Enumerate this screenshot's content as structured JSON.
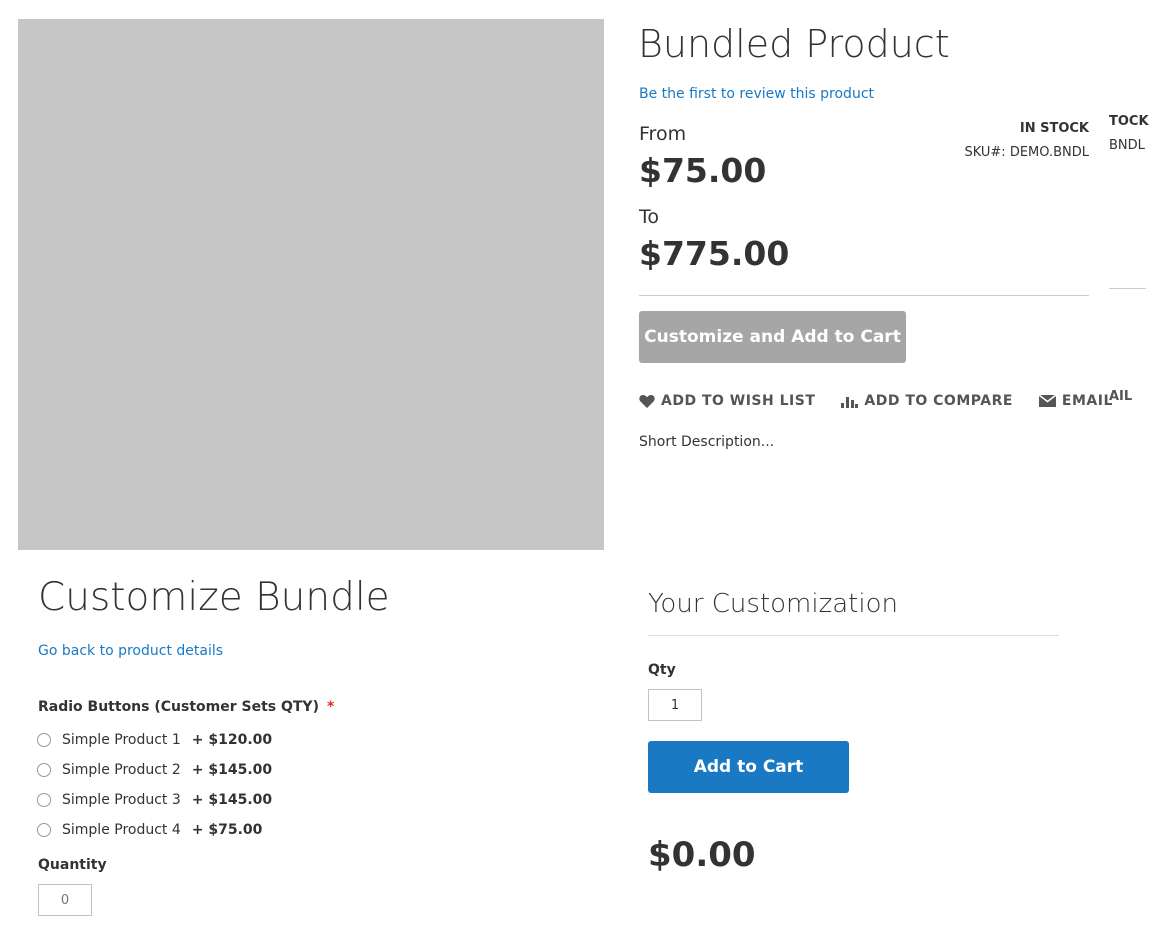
{
  "product": {
    "title": "Bundled Product",
    "review_link": "Be the first to review this product",
    "from_label": "From",
    "from_price": "$75.00",
    "to_label": "To",
    "to_price": "$775.00",
    "stock": "IN STOCK",
    "sku_label": "SKU#:",
    "sku_value": "DEMO.BNDL",
    "sku_full": "SKU#:  DEMO.BNDL",
    "ghost_stock": "TOCK",
    "ghost_sku": "BNDL",
    "ghost_email": "AIL",
    "customize_button": "Customize and Add to Cart",
    "short_description": "Short Description..."
  },
  "actions": {
    "wishlist": "ADD TO WISH LIST",
    "compare": "ADD TO COMPARE",
    "email": "EMAIL"
  },
  "bundle": {
    "title": "Customize Bundle",
    "back_link": "Go back to product details",
    "option_title": "Radio Buttons (Customer Sets QTY)",
    "required_mark": "*",
    "options": [
      {
        "name": "Simple Product 1",
        "price": "+ $120.00"
      },
      {
        "name": "Simple Product 2",
        "price": "+ $145.00"
      },
      {
        "name": "Simple Product 3",
        "price": "+ $145.00"
      },
      {
        "name": "Simple Product 4",
        "price": "+ $75.00"
      }
    ],
    "quantity_label": "Quantity",
    "quantity_placeholder": "0"
  },
  "summary": {
    "title": "Your Customization",
    "qty_label": "Qty",
    "qty_value": "1",
    "add_to_cart": "Add to Cart",
    "total": "$0.00"
  },
  "colors": {
    "link": "#1979c3",
    "primary_button": "#1979c3",
    "disabled_button": "#a6a6a6",
    "image_placeholder": "#c6c6c6",
    "required": "#e02b27"
  },
  "icons": {
    "wishlist": "heart-icon",
    "compare": "bar-chart-icon",
    "email": "envelope-icon"
  }
}
